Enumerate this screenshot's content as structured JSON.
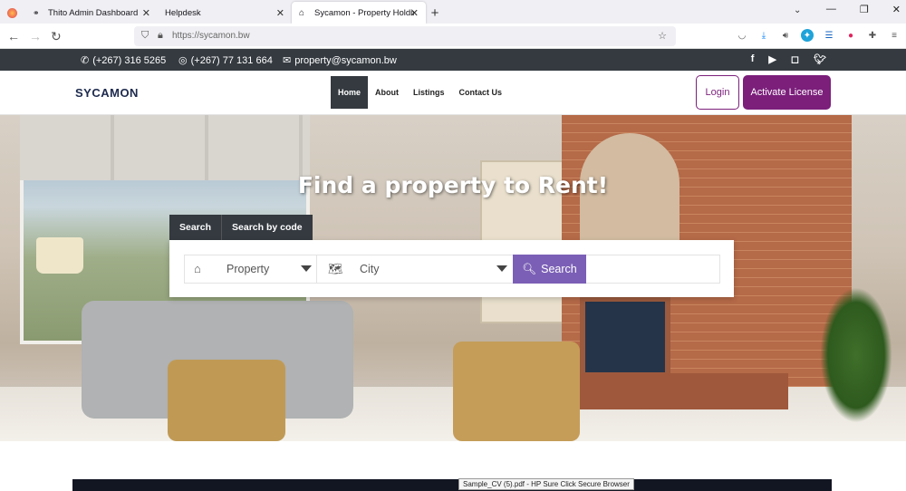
{
  "browser": {
    "tabs": [
      {
        "title": "Thito Admin Dashboard",
        "icon": "glasses-icon"
      },
      {
        "title": "Helpdesk",
        "icon": ""
      },
      {
        "title": "Sycamon - Property Holding Co",
        "icon": "house-icon",
        "active": true
      }
    ],
    "url_display": "https://sycamon.bw",
    "tooltip": "Sample_CV (5).pdf - HP Sure Click Secure Browser"
  },
  "topbar": {
    "phone1": "(+267) 316 5265",
    "phone2": "(+267) 77 131 664",
    "email": "property@sycamon.bw",
    "socials": [
      "facebook-icon",
      "youtube-icon",
      "instagram-icon",
      "twitter-icon"
    ]
  },
  "header": {
    "brand": "SYCAMON",
    "menu": [
      "Home",
      "About",
      "Listings",
      "Contact Us"
    ],
    "login": "Login",
    "activate": "Activate License"
  },
  "hero": {
    "title": "Find a property to Rent!",
    "search_tabs": [
      "Search",
      "Search by code"
    ],
    "property_select": "Property",
    "city_select": "City",
    "search_button": "Search"
  },
  "colors": {
    "accent": "#7b1f7b",
    "search_button": "#7b5fb6",
    "dark": "#343a40"
  }
}
